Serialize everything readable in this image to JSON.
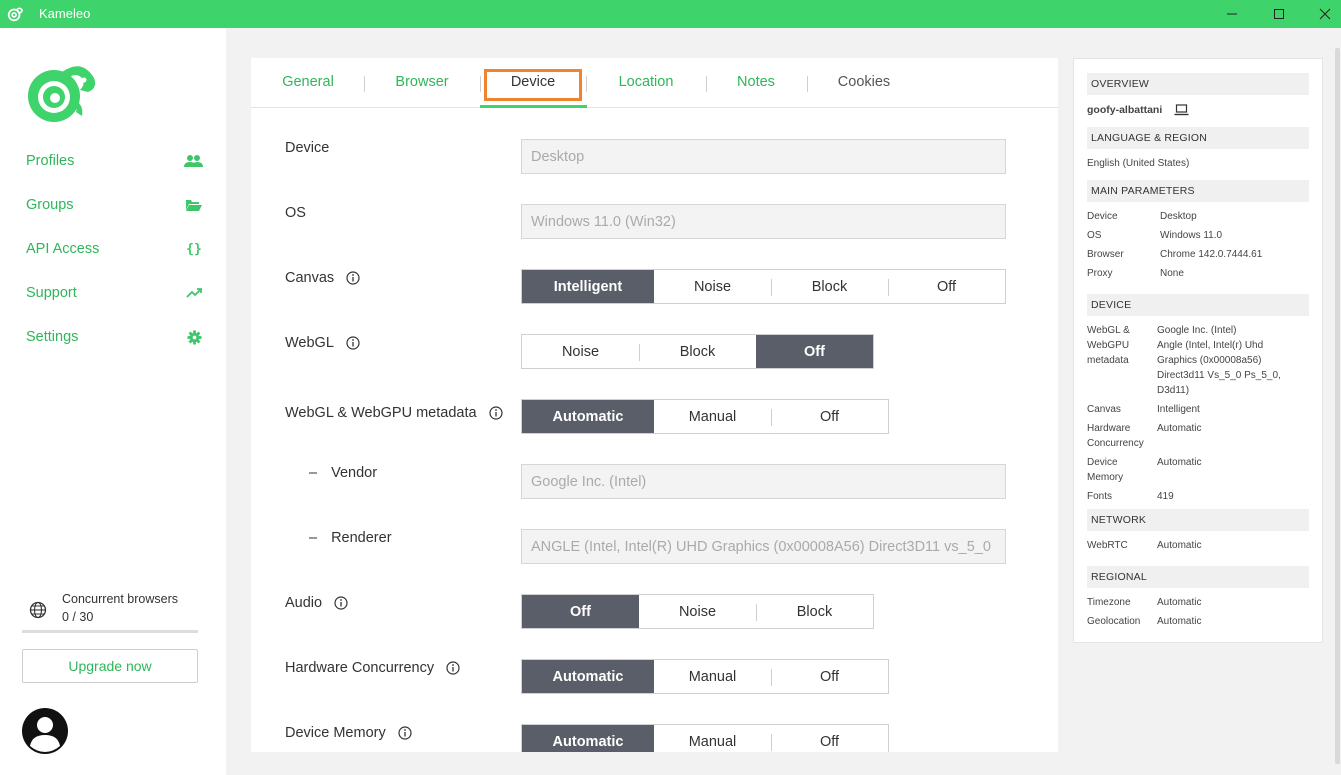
{
  "app": {
    "title": "Kameleo"
  },
  "sidebar": {
    "items": [
      {
        "label": "Profiles",
        "icon": "users-icon"
      },
      {
        "label": "Groups",
        "icon": "folder-open-icon"
      },
      {
        "label": "API Access",
        "icon": "code-braces-icon"
      },
      {
        "label": "Support",
        "icon": "trend-up-icon"
      },
      {
        "label": "Settings",
        "icon": "gear-icon"
      }
    ],
    "concurrent_label": "Concurrent browsers",
    "concurrent_value": "0 / 30",
    "upgrade_label": "Upgrade now"
  },
  "tabs": [
    {
      "label": "General"
    },
    {
      "label": "Browser"
    },
    {
      "label": "Device",
      "active": true
    },
    {
      "label": "Location"
    },
    {
      "label": "Notes"
    },
    {
      "label": "Cookies"
    }
  ],
  "form": {
    "device": {
      "label": "Device",
      "value": "Desktop"
    },
    "os": {
      "label": "OS",
      "value": "Windows 11.0 (Win32)"
    },
    "canvas": {
      "label": "Canvas",
      "options": [
        "Intelligent",
        "Noise",
        "Block",
        "Off"
      ],
      "selected": "Intelligent"
    },
    "webgl": {
      "label": "WebGL",
      "options": [
        "Noise",
        "Block",
        "Off"
      ],
      "selected": "Off"
    },
    "webgl_meta": {
      "label": "WebGL & WebGPU metadata",
      "options": [
        "Automatic",
        "Manual",
        "Off"
      ],
      "selected": "Automatic"
    },
    "vendor": {
      "dash": "–",
      "label": "Vendor",
      "value": "Google Inc. (Intel)"
    },
    "renderer": {
      "dash": "–",
      "label": "Renderer",
      "value": "ANGLE (Intel, Intel(R) UHD Graphics (0x00008A56) Direct3D11 vs_5_0"
    },
    "audio": {
      "label": "Audio",
      "options": [
        "Off",
        "Noise",
        "Block"
      ],
      "selected": "Off"
    },
    "hw_concurrency": {
      "label": "Hardware Concurrency",
      "options": [
        "Automatic",
        "Manual",
        "Off"
      ],
      "selected": "Automatic"
    },
    "device_memory": {
      "label": "Device Memory",
      "options": [
        "Automatic",
        "Manual",
        "Off"
      ],
      "selected": "Automatic"
    }
  },
  "overview": {
    "heading": "OVERVIEW",
    "profile_name": "goofy-albattani",
    "lang_heading": "LANGUAGE & REGION",
    "language": "English (United States)",
    "main_heading": "MAIN PARAMETERS",
    "main": [
      {
        "k": "Device",
        "v": "Desktop"
      },
      {
        "k": "OS",
        "v": "Windows 11.0"
      },
      {
        "k": "Browser",
        "v": "Chrome 142.0.7444.61"
      },
      {
        "k": "Proxy",
        "v": "None"
      }
    ],
    "device_heading": "DEVICE",
    "device_rows": [
      {
        "k": "WebGL & WebGPU metadata",
        "k_lines": [
          "WebGL &",
          "WebGPU",
          "metadata"
        ],
        "v_lines": [
          "Google Inc. (Intel)",
          "Angle (Intel, Intel(r) Uhd",
          "Graphics (0x00008a56)",
          "Direct3d11 Vs_5_0 Ps_5_0,",
          "D3d11)"
        ]
      },
      {
        "k_lines": [
          "Canvas"
        ],
        "v_lines": [
          "Intelligent"
        ]
      },
      {
        "k_lines": [
          "Hardware",
          "Concurrency"
        ],
        "v_lines": [
          "Automatic"
        ]
      },
      {
        "k_lines": [
          "Device",
          "Memory"
        ],
        "v_lines": [
          "Automatic"
        ]
      },
      {
        "k_lines": [
          "Fonts"
        ],
        "v_lines": [
          "419"
        ]
      }
    ],
    "network_heading": "NETWORK",
    "network": [
      {
        "k": "WebRTC",
        "v": "Automatic"
      }
    ],
    "regional_heading": "REGIONAL",
    "regional": [
      {
        "k": "Timezone",
        "v": "Automatic"
      },
      {
        "k": "Geolocation",
        "v": "Automatic"
      }
    ]
  },
  "colors": {
    "accent": "#3fd36b",
    "accent_text": "#2fb65a",
    "selected_segment": "#595e69",
    "highlight": "#f0832d"
  }
}
